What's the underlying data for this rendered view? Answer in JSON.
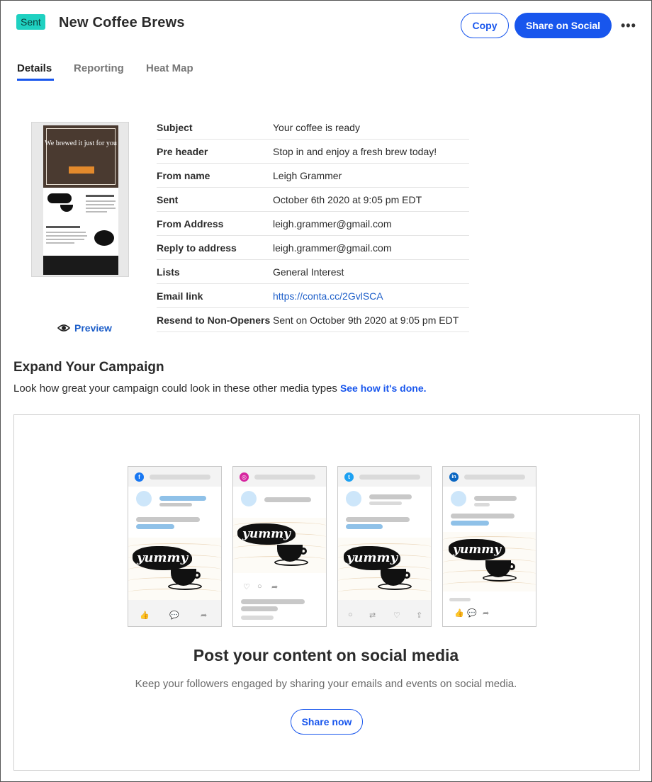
{
  "header": {
    "status_badge": "Sent",
    "title": "New Coffee Brews",
    "copy_label": "Copy",
    "share_social_label": "Share on Social",
    "more_label": "•••"
  },
  "tabs": [
    {
      "label": "Details",
      "active": true
    },
    {
      "label": "Reporting",
      "active": false
    },
    {
      "label": "Heat Map",
      "active": false
    }
  ],
  "thumbnail": {
    "hero_text": "We brewed it just for you"
  },
  "preview_label": "Preview",
  "details": [
    {
      "key": "Subject",
      "value": "Your coffee is ready"
    },
    {
      "key": "Pre header",
      "value": "Stop in and enjoy a fresh brew today!"
    },
    {
      "key": "From name",
      "value": "Leigh Grammer"
    },
    {
      "key": "Sent",
      "value": "October 6th 2020 at 9:05 pm EDT"
    },
    {
      "key": "From Address",
      "value": "leigh.grammer@gmail.com"
    },
    {
      "key": "Reply to address",
      "value": "leigh.grammer@gmail.com"
    },
    {
      "key": "Lists",
      "value": "General Interest"
    },
    {
      "key": "Email link",
      "value": "https://conta.cc/2GvlSCA"
    },
    {
      "key": "Resend to Non-Openers",
      "value": "Sent on October 9th 2020 at 9:05 pm EDT"
    }
  ],
  "expand": {
    "title": "Expand Your Campaign",
    "subtitle": "Look how great your campaign could look in these other media types",
    "link": "See how it's done."
  },
  "social_cards": [
    {
      "network": "facebook",
      "icon": "facebook-icon",
      "glyph": "f",
      "color": "#1877f2"
    },
    {
      "network": "instagram",
      "icon": "instagram-icon",
      "glyph": "◎",
      "color": "#d6249f"
    },
    {
      "network": "twitter",
      "icon": "twitter-icon",
      "glyph": "t",
      "color": "#1da1f2"
    },
    {
      "network": "linkedin",
      "icon": "linkedin-icon",
      "glyph": "in",
      "color": "#0a66c2"
    }
  ],
  "art_text": "yummy",
  "social": {
    "title": "Post your content on social media",
    "subtitle": "Keep your followers engaged by sharing your emails and events on social media.",
    "share_now_label": "Share now"
  }
}
